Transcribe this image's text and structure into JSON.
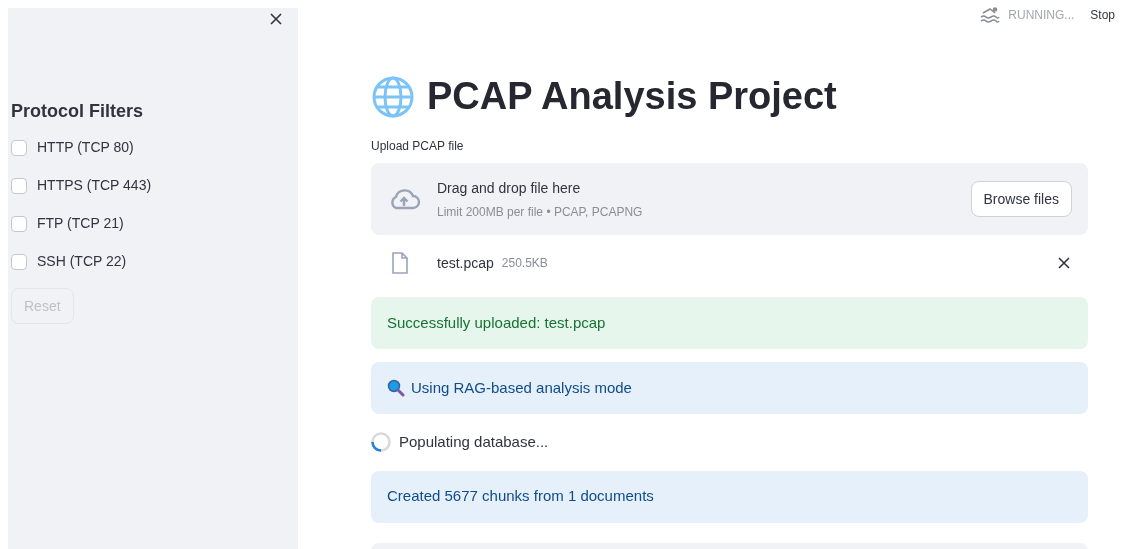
{
  "sidebar": {
    "title": "Protocol Filters",
    "filters": [
      {
        "label": "HTTP (TCP 80)",
        "checked": false
      },
      {
        "label": "HTTPS (TCP 443)",
        "checked": false
      },
      {
        "label": "FTP (TCP 21)",
        "checked": false
      },
      {
        "label": "SSH (TCP 22)",
        "checked": false
      }
    ],
    "reset": {
      "label": "Reset",
      "disabled": true
    }
  },
  "status": {
    "text": "RUNNING...",
    "stop": "Stop"
  },
  "title": "PCAP Analysis Project",
  "uploader": {
    "label": "Upload PCAP file",
    "prompt": "Drag and drop file here",
    "limit": "Limit 200MB per file • PCAP, PCAPNG",
    "button": "Browse files",
    "file": {
      "name": "test.pcap",
      "size": "250.5KB"
    }
  },
  "messages": [
    {
      "kind": "success",
      "text": "Successfully uploaded: test.pcap"
    },
    {
      "kind": "info",
      "icon": true,
      "text": "Using RAG-based analysis mode"
    },
    {
      "kind": "spinner",
      "text": "Populating database..."
    },
    {
      "kind": "info",
      "icon": false,
      "text": "Created 5677 chunks from 1 documents"
    }
  ]
}
